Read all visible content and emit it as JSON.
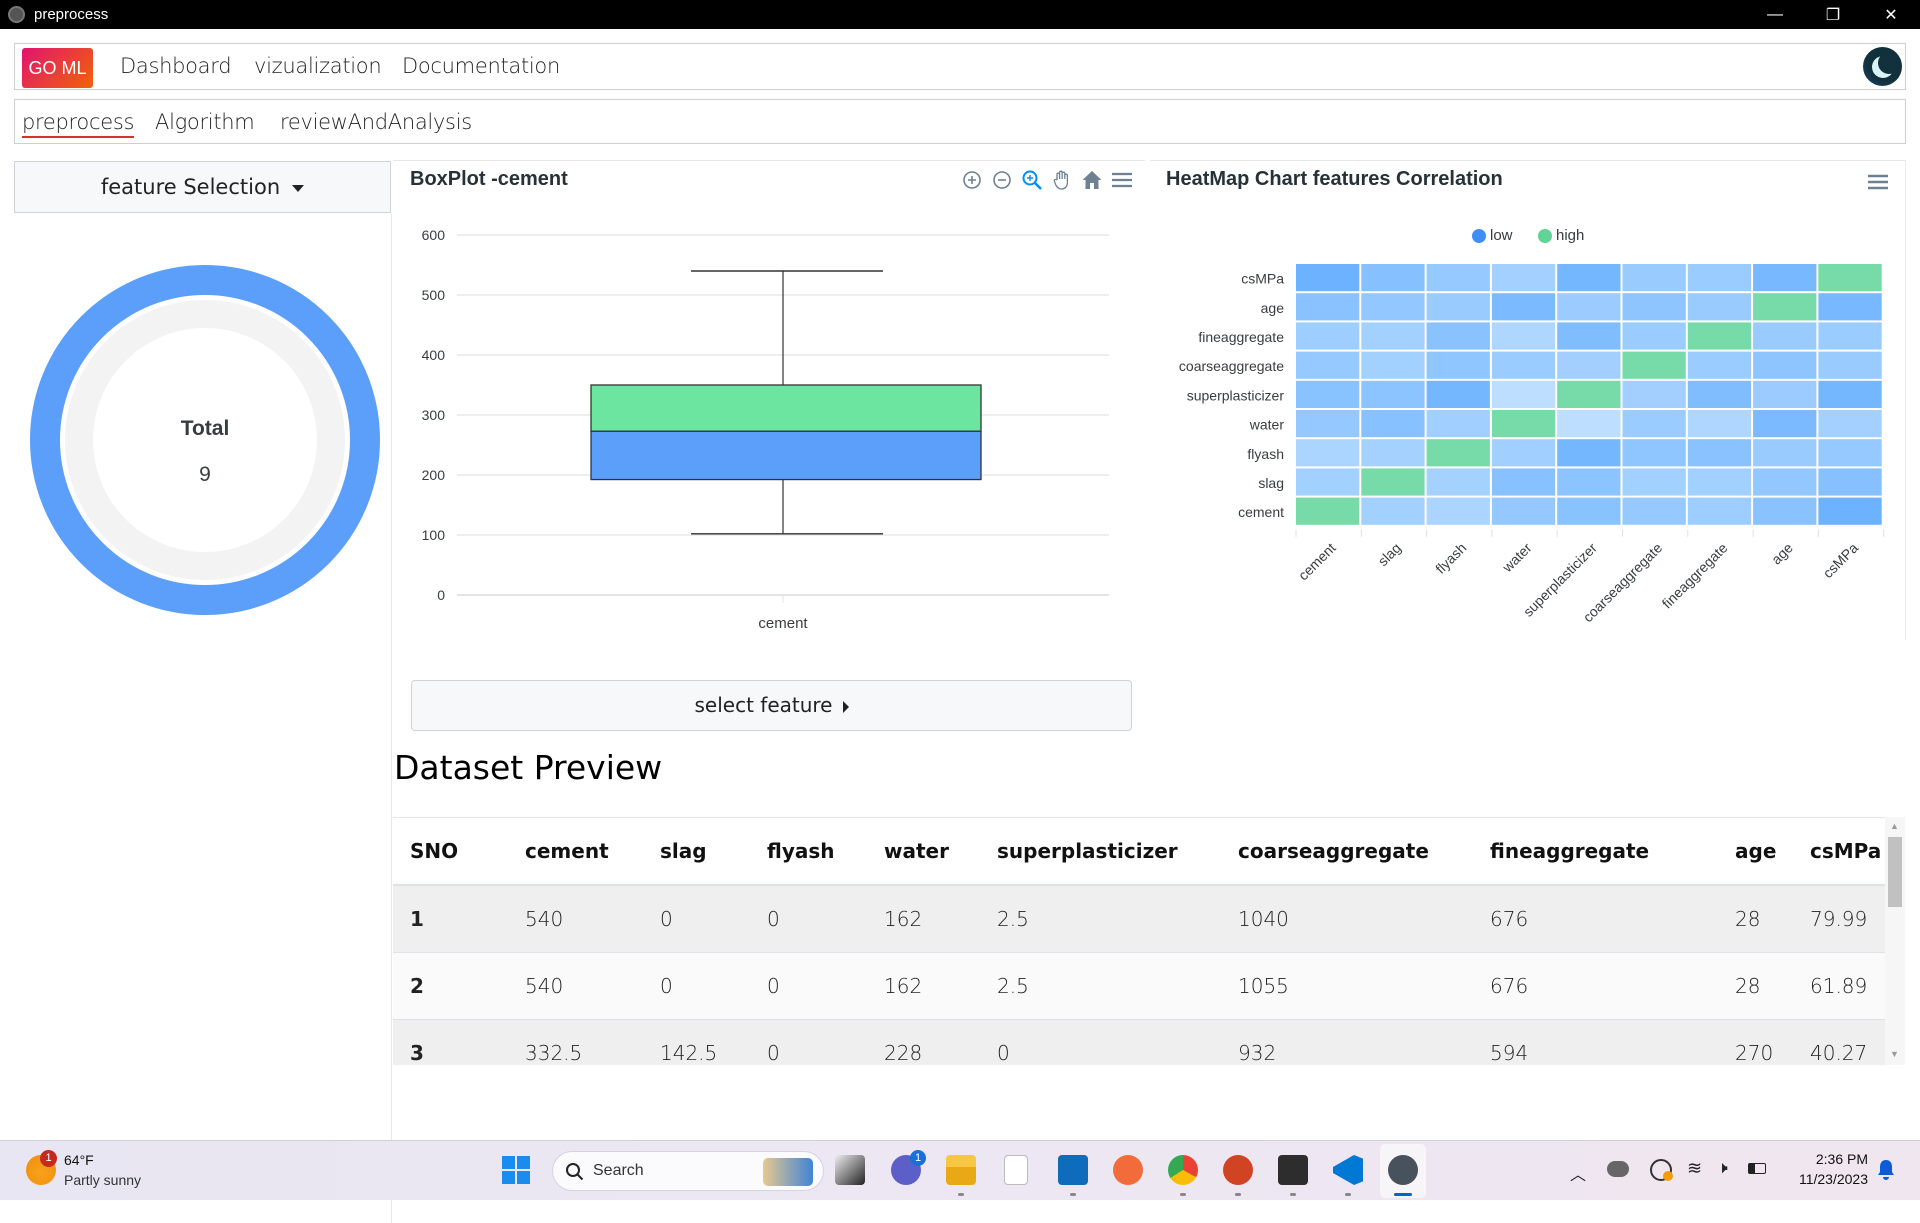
{
  "window": {
    "title": "preprocess",
    "controls": {
      "minimize": "—",
      "restore": "❐",
      "close": "✕"
    }
  },
  "navbar": {
    "brand": "GO ML",
    "links": [
      "Dashboard",
      "vizualization",
      "Documentation"
    ],
    "theme_toggle_icon": "moon-icon"
  },
  "subnav": {
    "tabs": [
      "preprocess",
      "Algorithm",
      "reviewAndAnalysis"
    ],
    "active_tab": "preprocess"
  },
  "left_panel": {
    "feature_selection_label": "feature Selection",
    "donut": {
      "title": "Total",
      "value": "9",
      "color": "#5b9ffb",
      "track_color": "#f3f3f3"
    }
  },
  "boxplot": {
    "title": "BoxPlot -cement",
    "toolbar": [
      "zoom-in-icon",
      "zoom-out-icon",
      "selection-zoom-icon",
      "pan-hand-icon",
      "home-reset-icon",
      "menu-icon"
    ],
    "select_feature_label": "select feature"
  },
  "heatmap": {
    "title": "HeatMap Chart features Correlation",
    "menu_icon": "menu-icon"
  },
  "chart_data": [
    {
      "type": "boxplot",
      "title": "BoxPlot -cement",
      "categories": [
        "cement"
      ],
      "series": [
        {
          "name": "cement",
          "min": 102,
          "q1": 192.4,
          "median": 272.9,
          "q3": 350,
          "max": 540
        }
      ],
      "ylim": [
        0,
        600
      ],
      "yticks": [
        0,
        100,
        200,
        300,
        400,
        500,
        600
      ],
      "colors": {
        "upper": "#6ce5a0",
        "lower": "#5b9ffb"
      },
      "grid": true
    },
    {
      "type": "heatmap",
      "title": "HeatMap Chart features Correlation",
      "legend": {
        "position": "top-center",
        "items": [
          {
            "label": "low",
            "color": "#3f8ef5"
          },
          {
            "label": "high",
            "color": "#5fd495"
          }
        ]
      },
      "x": [
        "cement",
        "slag",
        "flyash",
        "water",
        "superplasticizer",
        "coarseaggregate",
        "fineaggregate",
        "age",
        "csMPa"
      ],
      "y": [
        "cement",
        "slag",
        "flyash",
        "water",
        "superplasticizer",
        "coarseaggregate",
        "fineaggregate",
        "age",
        "csMPa"
      ],
      "values": [
        [
          1.0,
          -0.28,
          -0.4,
          -0.08,
          0.09,
          -0.11,
          -0.22,
          0.08,
          0.5
        ],
        [
          -0.28,
          1.0,
          -0.32,
          0.11,
          0.04,
          -0.28,
          -0.28,
          -0.04,
          0.13
        ],
        [
          -0.4,
          -0.32,
          1.0,
          -0.26,
          0.38,
          -0.01,
          0.08,
          -0.15,
          -0.11
        ],
        [
          -0.08,
          0.11,
          -0.26,
          1.0,
          -0.66,
          -0.18,
          -0.45,
          0.28,
          -0.29
        ],
        [
          0.09,
          0.04,
          0.38,
          -0.66,
          1.0,
          -0.27,
          0.22,
          -0.19,
          0.37
        ],
        [
          -0.11,
          -0.28,
          -0.01,
          -0.18,
          -0.27,
          1.0,
          -0.18,
          0.0,
          -0.16
        ],
        [
          -0.22,
          -0.28,
          0.08,
          -0.45,
          0.22,
          -0.18,
          1.0,
          -0.16,
          -0.17
        ],
        [
          0.08,
          -0.04,
          -0.15,
          0.28,
          -0.19,
          0.0,
          -0.16,
          1.0,
          0.33
        ],
        [
          0.5,
          0.13,
          -0.11,
          -0.29,
          0.37,
          -0.16,
          -0.17,
          0.33,
          1.0
        ]
      ],
      "vrange": [
        -1,
        1
      ]
    }
  ],
  "dataset": {
    "heading": "Dataset Preview",
    "columns": [
      "SNO",
      "cement",
      "slag",
      "flyash",
      "water",
      "superplasticizer",
      "coarseaggregate",
      "fineaggregate",
      "age",
      "csMPa"
    ],
    "rows": [
      [
        "1",
        "540",
        "0",
        "0",
        "162",
        "2.5",
        "1040",
        "676",
        "28",
        "79.99"
      ],
      [
        "2",
        "540",
        "0",
        "0",
        "162",
        "2.5",
        "1055",
        "676",
        "28",
        "61.89"
      ],
      [
        "3",
        "332.5",
        "142.5",
        "0",
        "228",
        "0",
        "932",
        "594",
        "270",
        "40.27"
      ]
    ]
  },
  "taskbar": {
    "weather": {
      "temp": "64°F",
      "desc": "Partly sunny",
      "badge": "1"
    },
    "search_label": "Search",
    "apps": [
      "windows-start-icon",
      "search",
      "task-view-icon",
      "teams-icon",
      "file-explorer-icon",
      "notepad-icon",
      "outlook-icon",
      "postman-icon",
      "chrome-icon",
      "powerpoint-icon",
      "terminal-icon",
      "vscode-icon",
      "electron-app-icon"
    ],
    "teams_badge": "1",
    "time": "2:36 PM",
    "date": "11/23/2023"
  }
}
